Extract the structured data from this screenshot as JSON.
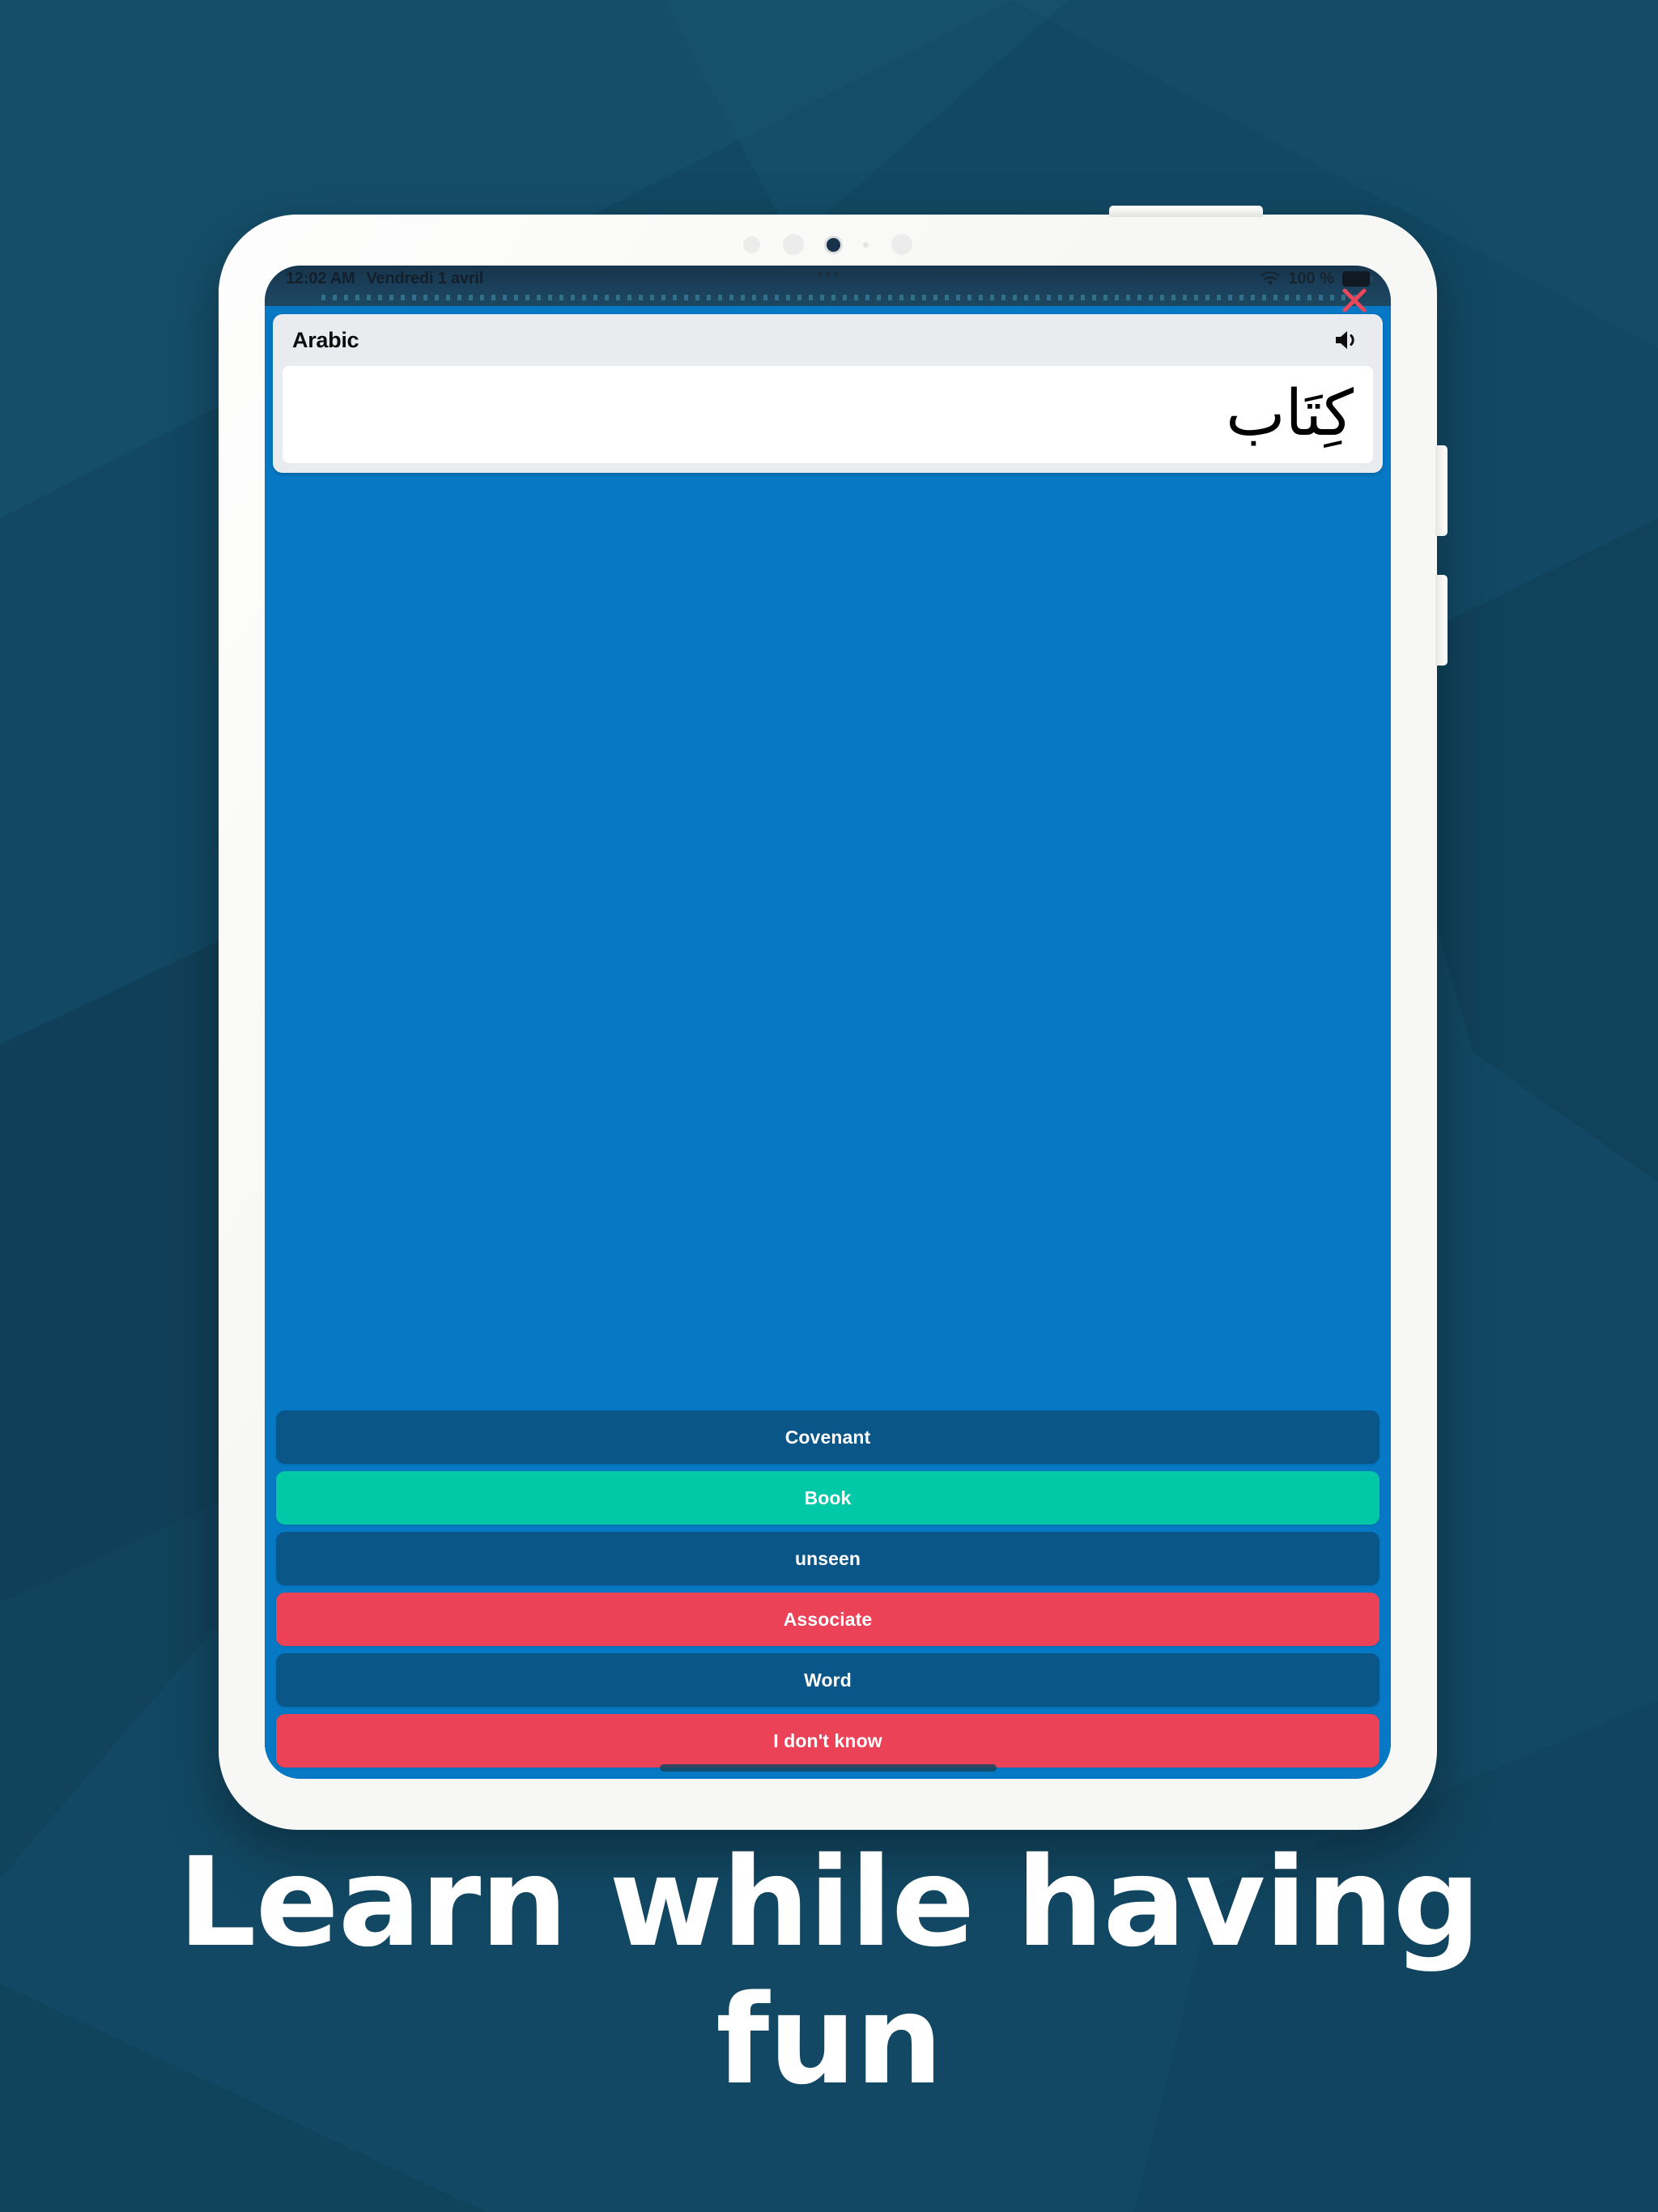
{
  "background": {
    "base_color": "#124863",
    "shade_color": "#0f3d55",
    "highlight_color": "#17536f"
  },
  "device": {
    "name": "tablet-mockup",
    "frame_color": "#f7f7f5",
    "camera_dots": 5,
    "buttons": [
      "power-button",
      "volume-up-button",
      "volume-down-button"
    ]
  },
  "status_bar": {
    "time": "12:02 AM",
    "date": "Vendredi 1 avril",
    "battery_text": "100 %",
    "wifi_icon": "wifi-icon",
    "battery_icon": "battery-full-icon",
    "close_marker_icon": "red-x-icon",
    "background_color": "#1b415c"
  },
  "app": {
    "accent_color": "#0678c4",
    "card": {
      "language_label": "Arabic",
      "speaker_icon": "speaker-icon",
      "prompt_word": "كِتَاب",
      "header_bg": "#e9ebee",
      "body_bg": "#ffffff"
    },
    "answers": [
      {
        "label": "Covenant",
        "state": "neutral",
        "color": "#0a5688"
      },
      {
        "label": "Book",
        "state": "correct",
        "color": "#01c9a7"
      },
      {
        "label": "unseen",
        "state": "neutral",
        "color": "#0a5688"
      },
      {
        "label": "Associate",
        "state": "wrong",
        "color": "#eb4258"
      },
      {
        "label": "Word",
        "state": "neutral",
        "color": "#0a5688"
      },
      {
        "label": "I don't know",
        "state": "wrong",
        "color": "#eb4258"
      }
    ],
    "home_indicator": "home-indicator"
  },
  "promo": {
    "headline": "Learn while having fun",
    "headline_color": "#ffffff"
  }
}
